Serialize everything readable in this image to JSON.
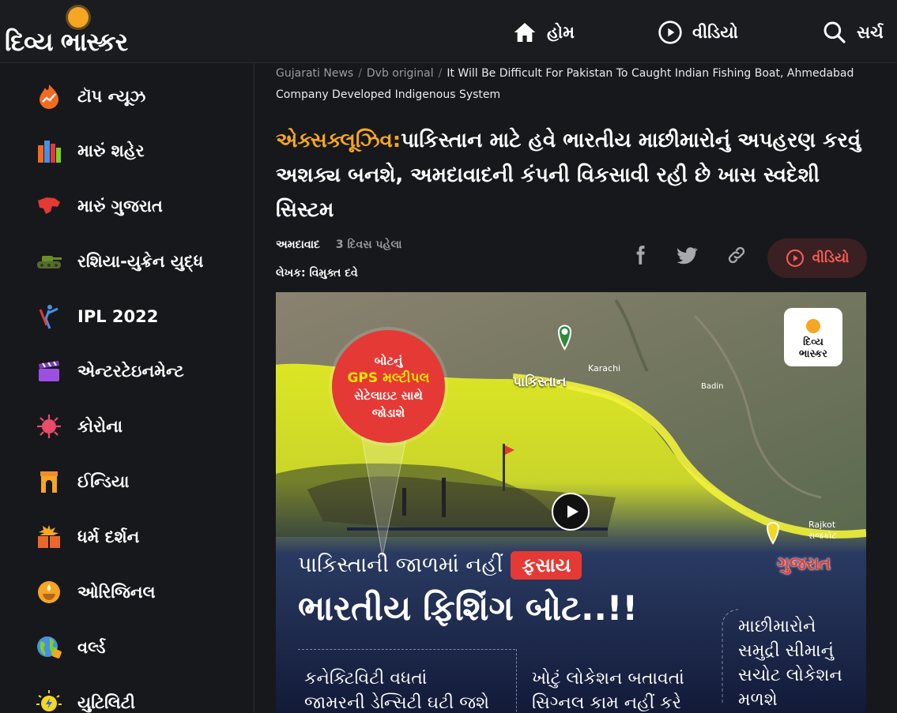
{
  "header": {
    "logo_text": "દિવ્ય ભાસ્કર",
    "nav": {
      "home": "હોમ",
      "video": "વીડિયો",
      "search": "સર્ચ"
    }
  },
  "sidebar": {
    "items": [
      {
        "label": "ટૉપ ન્યૂઝ",
        "icon": "trending-icon"
      },
      {
        "label": "મારું શહેર",
        "icon": "city-icon"
      },
      {
        "label": "મારું ગુજરાત",
        "icon": "gujarat-map-icon"
      },
      {
        "label": "રશિયા-યુક્રેન યુદ્ધ",
        "icon": "tank-icon"
      },
      {
        "label": "IPL 2022",
        "icon": "cricket-icon"
      },
      {
        "label": "એન્ટરટેઇનમેન્ટ",
        "icon": "clapper-icon"
      },
      {
        "label": "કોરોના",
        "icon": "virus-icon"
      },
      {
        "label": "ઈન્ડિયા",
        "icon": "india-gate-icon"
      },
      {
        "label": "ધર્મ દર્શન",
        "icon": "book-icon"
      },
      {
        "label": "ઓરિજિનલ",
        "icon": "lamp-icon"
      },
      {
        "label": "વર્લ્ડ",
        "icon": "globe-icon"
      },
      {
        "label": "યુટિલિટી",
        "icon": "bulb-icon"
      }
    ]
  },
  "article": {
    "breadcrumb": [
      "Gujarati News",
      "Dvb original",
      "It Will Be Difficult For Pakistan To Caught Indian Fishing Boat, Ahmedabad Company Developed Indigenous System"
    ],
    "headline_tag": "એક્સક્લૂઝિવ:",
    "headline": "પાકિસ્તાન માટે હવે ભારતીય માછીમારોનું અપહરણ કરવું અશક્ય બનશે, અમદાવાદની કંપની વિકસાવી રહી છે ખાસ સ્વદેશી સિસ્ટમ",
    "location": "અમદાવાદ",
    "time": "3 દિવસ પહેલા",
    "author": "લેખક: વિમુક્ત દવે",
    "video_button": "વીડિયો"
  },
  "hero": {
    "gps_line1": "બોટનું",
    "gps_line2": "GPS મલ્ટીપલ",
    "gps_line3": "સેટેલાઇટ સાથે",
    "gps_line4": "જોડાશે",
    "pakistan": "પાકિસ્તાન",
    "karachi": "Karachi",
    "badin": "Badin",
    "rajkot_en": "Rajkot",
    "rajkot_gu": "રાજકોટ",
    "gujarat": "ગુજરાત",
    "logo_line1": "દિવ્ય",
    "logo_line2": "ભાસ્કર",
    "sub_headline": "પાકિસ્તાની જાળમાં નહીં",
    "sub_headline_red": "ફસાય",
    "big_headline": "ભારતીય ફિશિંગ બોટ..!!",
    "col1_line1": "કનેક્ટિવિટી વધતાં",
    "col1_line2": "જામરની ડેન્સિટી ઘટી જશે",
    "col2_line1": "ખોટું લોકેશન બતાવતાં",
    "col2_line2": "સિગ્નલ કામ નહીં કરે",
    "col3_line1": "માછીમારોને",
    "col3_line2": "સમુદ્રી સીમાનું",
    "col3_line3": "સચોટ લોકેશન",
    "col3_line4": "મળશે"
  },
  "colors": {
    "accent": "#f5a623",
    "red": "#e53935",
    "video_red": "#ff5e57",
    "background": "#17181c"
  }
}
